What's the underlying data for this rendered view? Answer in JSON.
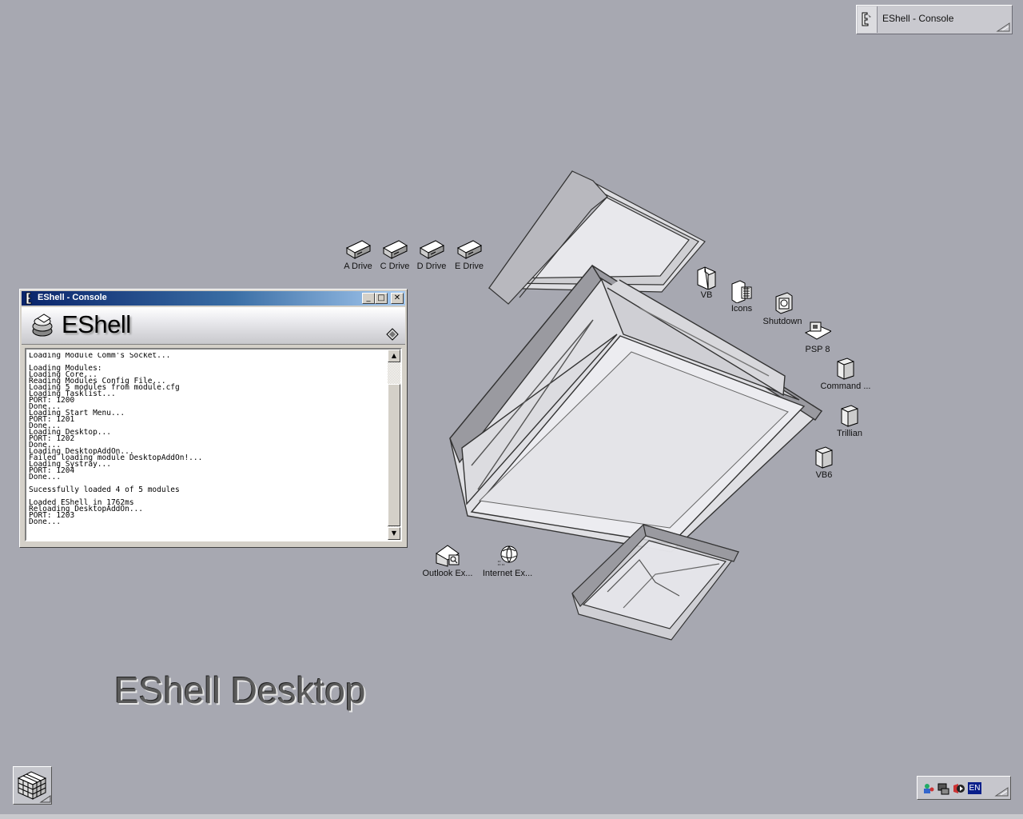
{
  "taskbar_top": {
    "title": "EShell - Console"
  },
  "desktop_icons": [
    {
      "label": "A Drive",
      "icon": "drive-icon"
    },
    {
      "label": "C Drive",
      "icon": "drive-icon"
    },
    {
      "label": "D Drive",
      "icon": "drive-icon"
    },
    {
      "label": "E Drive",
      "icon": "drive-icon"
    },
    {
      "label": "VB",
      "icon": "folder-icon"
    },
    {
      "label": "Icons",
      "icon": "icons-folder-icon"
    },
    {
      "label": "Shutdown",
      "icon": "shutdown-icon"
    },
    {
      "label": "PSP 8",
      "icon": "psp-icon"
    },
    {
      "label": "Command ...",
      "icon": "cube-icon"
    },
    {
      "label": "Trillian",
      "icon": "cube-icon"
    },
    {
      "label": "VB6",
      "icon": "cube-icon"
    },
    {
      "label": "Outlook Ex...",
      "icon": "outlook-icon"
    },
    {
      "label": "Internet Ex...",
      "icon": "internet-explorer-icon"
    }
  ],
  "console": {
    "title": "EShell - Console",
    "banner": "EShell",
    "buttons": {
      "minimize": "_",
      "maximize": "□",
      "close": "✕"
    },
    "log": "Loading Module Comm's Socket...\n\nLoading Modules:\nLoading Core...\nReading Modules Config File...\nLoading 5 modules from module.cfg\nLoading Tasklist...\nPORT: 1200\nDone...\nLoading Start Menu...\nPORT: 1201\nDone...\nLoading Desktop...\nPORT: 1202\nDone...\nLoading DesktopAddOn...\nFailed loading module DesktopAddOn!...\nLoading Systray...\nPORT: 1204\nDone...\n\nSucessfully loaded 4 of 5 modules\n\nLoaded EShell in 1762ms\nReloading DesktopAddOn...\nPORT: 1203\nDone..."
  },
  "desktop_title": "EShell Desktop",
  "tray": {
    "language": "EN"
  },
  "colors": {
    "desktop": "#a7a8b1",
    "titlebar": "#0a246a",
    "window": "#d4d0c8"
  }
}
